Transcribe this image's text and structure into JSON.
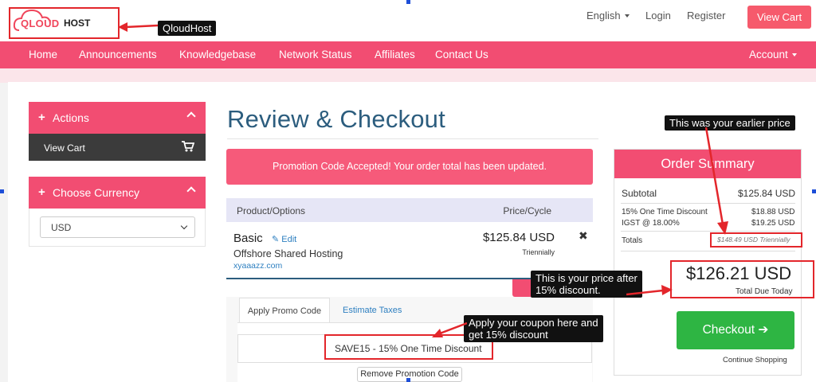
{
  "header": {
    "logo_q": "QLOUD",
    "logo_host": "HOST",
    "language": "English",
    "login": "Login",
    "register": "Register",
    "view_cart": "View Cart"
  },
  "nav": {
    "items": [
      "Home",
      "Announcements",
      "Knowledgebase",
      "Network Status",
      "Affiliates",
      "Contact Us"
    ],
    "account": "Account"
  },
  "sidebar": {
    "actions_title": "Actions",
    "view_cart": "View Cart",
    "currency_title": "Choose Currency",
    "currency_selected": "USD"
  },
  "main": {
    "title": "Review & Checkout",
    "alert": "Promotion Code Accepted! Your order total has been updated.",
    "table_headers": {
      "product": "Product/Options",
      "price": "Price/Cycle"
    },
    "product": {
      "name": "Basic",
      "edit": "Edit",
      "group": "Offshore Shared Hosting",
      "domain": "xyaaazz.com",
      "price": "$125.84 USD",
      "cycle": "Triennially"
    },
    "tabs": {
      "promo": "Apply Promo Code",
      "taxes": "Estimate Taxes"
    },
    "promo_applied": "SAVE15 - 15% One Time Discount",
    "remove_promo": "Remove Promotion Code"
  },
  "summary": {
    "title": "Order Summary",
    "subtotal_label": "Subtotal",
    "subtotal_value": "$125.84 USD",
    "discount_label": "15% One Time Discount",
    "discount_value": "$18.88 USD",
    "tax_label": "IGST @ 18.00%",
    "tax_value": "$19.25 USD",
    "totals_label": "Totals",
    "totals_value": "$148.49 USD Triennially",
    "total_due": "$126.21 USD",
    "total_due_label": "Total Due Today",
    "checkout": "Checkout",
    "continue": "Continue Shopping"
  },
  "annotations": {
    "logo": "QloudHost",
    "earlier_price": "This was your earlier price",
    "after_discount_1": "This is your price after",
    "after_discount_2": "15% discount.",
    "coupon_1": "Apply your coupon here and",
    "coupon_2": "get 15% discount"
  },
  "colors": {
    "brand_pink": "#f24d72",
    "title_blue": "#2c5d7e",
    "checkout_green": "#2eb543",
    "highlight_red": "#e3262b"
  }
}
